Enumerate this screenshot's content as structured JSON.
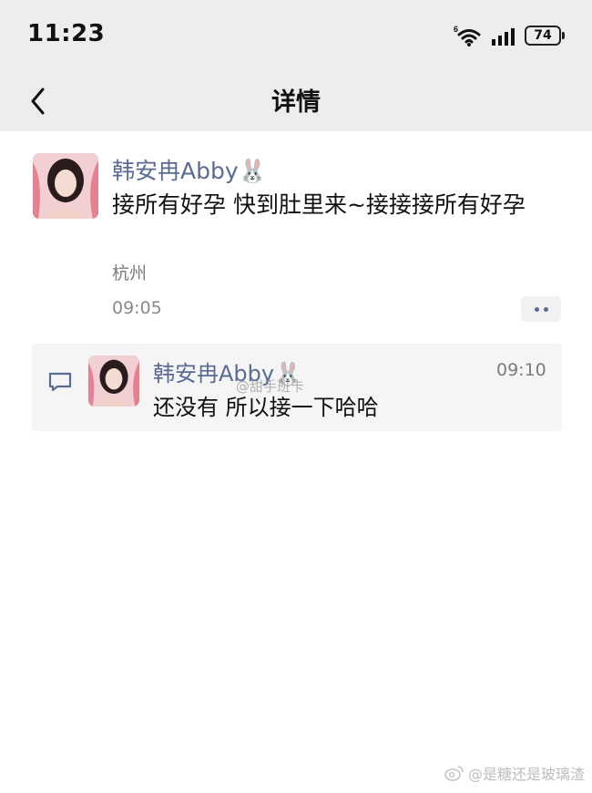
{
  "status_bar": {
    "time": "11:23",
    "network_badge": "6",
    "battery_level": "74",
    "icons": [
      "wifi-icon",
      "signal-icon",
      "battery-icon"
    ]
  },
  "nav": {
    "title": "详情",
    "back_icon": "chevron-left-icon"
  },
  "post": {
    "author": "韩安冉Abby🐰",
    "text": "接所有好孕 快到肚里来~接接接所有好孕",
    "location": "杭州",
    "time": "09:05",
    "more_icon": "more-dots-icon"
  },
  "comment": {
    "icon": "comment-icon",
    "author": "韩安冉Abby🐰",
    "time": "09:10",
    "text": "还没有 所以接一下哈哈"
  },
  "overlay_watermark": "@甜手班卡",
  "watermark": {
    "icon": "weibo-icon",
    "text": "@是糖还是玻璃渣"
  },
  "colors": {
    "header_bg": "#ededed",
    "name_link": "#5a6b94",
    "comment_bg": "#f5f5f5"
  }
}
